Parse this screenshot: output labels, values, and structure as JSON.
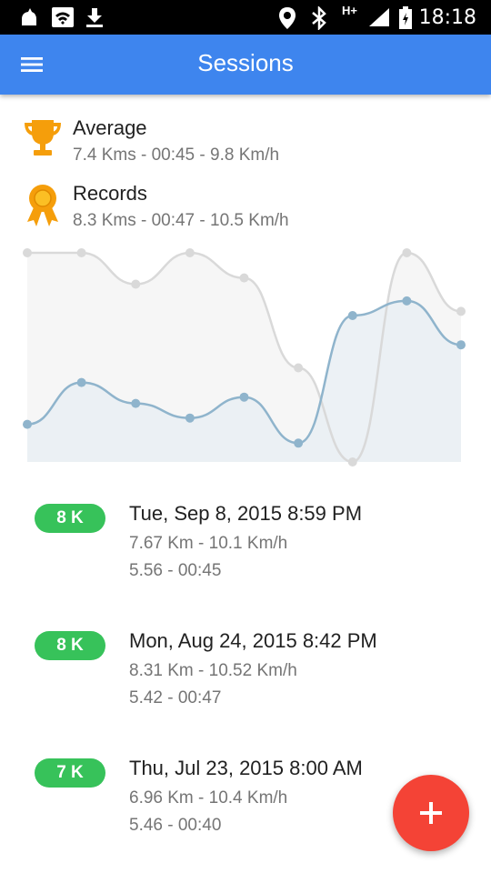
{
  "status_bar": {
    "time": "18:18",
    "network": "H+",
    "icons": [
      "notification-icon",
      "wifi-icon",
      "download-icon",
      "location-icon",
      "bluetooth-icon",
      "signal-icon",
      "battery-icon"
    ]
  },
  "app_bar": {
    "title": "Sessions",
    "color": "#3e85ee"
  },
  "summary": {
    "average": {
      "title": "Average",
      "value": "7.4 Kms - 00:45 - 9.8 Km/h",
      "icon": "trophy-icon"
    },
    "records": {
      "title": "Records",
      "value": "8.3 Kms - 00:47 - 10.5 Km/h",
      "icon": "medal-icon"
    }
  },
  "chart_data": {
    "type": "area",
    "x": [
      1,
      2,
      3,
      4,
      5,
      6,
      7,
      8,
      9
    ],
    "series": [
      {
        "values": [
          1.0,
          1.0,
          0.85,
          1.0,
          0.88,
          0.45,
          0.0,
          1.0,
          0.72
        ],
        "color": "#d9d9d9"
      },
      {
        "values": [
          0.18,
          0.38,
          0.28,
          0.21,
          0.31,
          0.09,
          0.7,
          0.77,
          0.56
        ],
        "color": "#8fb4cc"
      }
    ],
    "ylim": [
      0,
      1
    ],
    "grid": false
  },
  "sessions": [
    {
      "badge": "8 K",
      "date": "Tue, Sep 8, 2015 8:59 PM",
      "line1": "7.67 Km - 10.1 Km/h",
      "line2": "5.56 - 00:45"
    },
    {
      "badge": "8 K",
      "date": "Mon, Aug 24, 2015 8:42 PM",
      "line1": "8.31 Km - 10.52 Km/h",
      "line2": "5.42 - 00:47"
    },
    {
      "badge": "7 K",
      "date": "Thu, Jul 23, 2015 8:00 AM",
      "line1": "6.96 Km - 10.4 Km/h",
      "line2": "5.46 - 00:40"
    }
  ],
  "fab": {
    "icon": "plus-icon",
    "color": "#f44336"
  }
}
